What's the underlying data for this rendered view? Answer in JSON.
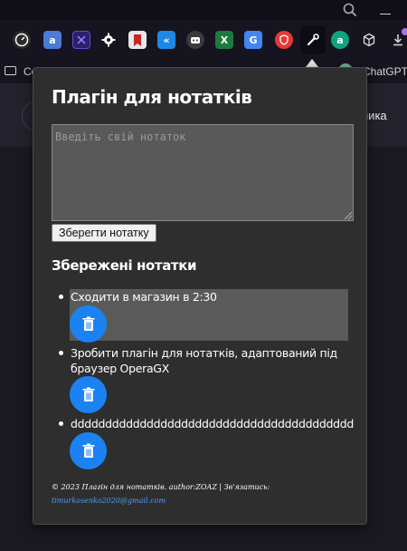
{
  "browser": {
    "bookmarks": [
      {
        "label": "Co"
      },
      {
        "label": "ChatGPT"
      }
    ],
    "page_text": "ника",
    "extensions": [
      {
        "icon": "speedometer-icon",
        "color": "#2b2b2b"
      },
      {
        "icon": "translate-icon",
        "color": "#4a7bd8"
      },
      {
        "icon": "crossed-box-icon",
        "color": "#2b1f6e"
      },
      {
        "icon": "gear-icon",
        "color": "#16151f"
      },
      {
        "icon": "bookmark-icon",
        "color": "#e8e8e8"
      },
      {
        "icon": "double-chevron-icon",
        "color": "#1e88e5"
      },
      {
        "icon": "robot-icon",
        "color": "#3a3a3a"
      },
      {
        "icon": "excel-icon",
        "color": "#1d7a3e"
      },
      {
        "icon": "google-translate-icon",
        "color": "#4285f4"
      },
      {
        "icon": "shield-icon",
        "color": "#e53935"
      },
      {
        "icon": "wrench-icon",
        "color": "#0d0c14"
      },
      {
        "icon": "chatgpt-icon",
        "color": "#10a37f"
      },
      {
        "icon": "cube-icon",
        "color": "#16151f"
      },
      {
        "icon": "download-icon",
        "color": "#16151f"
      }
    ]
  },
  "popup": {
    "title": "Плагін для нотатків",
    "input_placeholder": "Введіть свій нотаток",
    "input_value": "",
    "save_label": "Зберегти нотатку",
    "saved_heading": "Збережені нотатки",
    "notes": [
      {
        "text": "Сходити в магазин в 2:30"
      },
      {
        "text": "Зробити плагін для нотатків, адаптований під браузер OperaGX"
      },
      {
        "text": "ddddddddddddddddddddddddddddddddddddddddd"
      }
    ],
    "footer": {
      "text": "© 2023 Плагін для нотатків. author:ZOAZ | Зв'язатись:",
      "email": "timurkosenko2020@gmail.com"
    }
  },
  "colors": {
    "popup_bg": "#2e2e2e",
    "accent_blue": "#1b82f2",
    "note_highlight": "#5a5a5a"
  }
}
